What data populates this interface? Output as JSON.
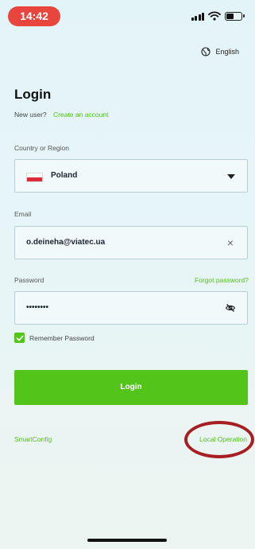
{
  "status_bar": {
    "time": "14:42",
    "battery_level": 0.45
  },
  "language": {
    "icon": "globe-icon",
    "label": "English"
  },
  "login_form": {
    "title": "Login",
    "new_user_text": "New user?",
    "create_account_link": "Create an account",
    "country_label": "Country or Region",
    "country_value": "Poland",
    "country_flag": "poland-flag",
    "email_label": "Email",
    "email_value": "o.deineha@viatec.ua",
    "clear_icon": "×",
    "password_label": "Password",
    "forgot_password_link": "Forgot password?",
    "password_value": "••••••••",
    "remember_label": "Remember Password",
    "remember_checked": true,
    "login_button": "Login"
  },
  "footer": {
    "smartconfig_link": "SmartConfig",
    "local_operation_link": "Local Operation"
  },
  "colors": {
    "accent": "#52c41a",
    "time_pill": "#e8453c",
    "annotation_circle": "#a61e21"
  }
}
